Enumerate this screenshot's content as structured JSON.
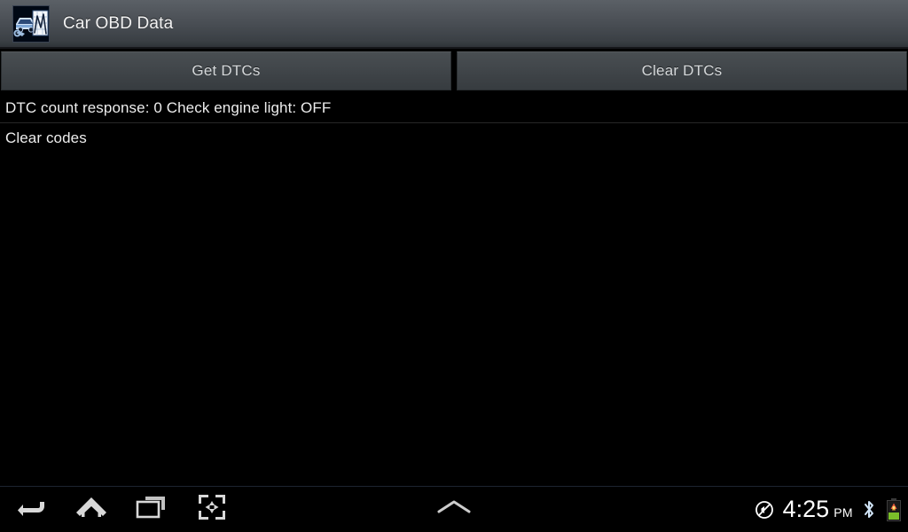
{
  "app": {
    "title": "Car OBD Data",
    "icon_name": "car-obd-app-icon"
  },
  "toolbar": {
    "get_dtcs_label": "Get DTCs",
    "clear_dtcs_label": "Clear DTCs"
  },
  "log": {
    "rows": [
      {
        "text": "DTC count response:  0 Check engine light: OFF",
        "divider": true
      },
      {
        "text": "Clear codes",
        "divider": false
      }
    ]
  },
  "navbar": {
    "back_icon": "back-arrow-icon",
    "home_icon": "home-icon",
    "recents_icon": "recent-apps-icon",
    "screenshot_icon": "screenshot-icon",
    "expand_icon": "chevron-up-icon"
  },
  "status": {
    "mute_icon": "no-sound-icon",
    "time": "4:25",
    "ampm": "PM",
    "bluetooth_icon": "bluetooth-icon",
    "battery_icon": "battery-low-icon"
  },
  "colors": {
    "screen_background": "#000000",
    "titlebar_top": "#5b6066",
    "titlebar_bottom": "#2e3338",
    "button_face": "#43484c",
    "button_text": "#d5d8da",
    "list_text": "#ededed",
    "divider": "#272727",
    "nav_icon": "#d8d8d8",
    "clock_text": "#ffffff"
  }
}
